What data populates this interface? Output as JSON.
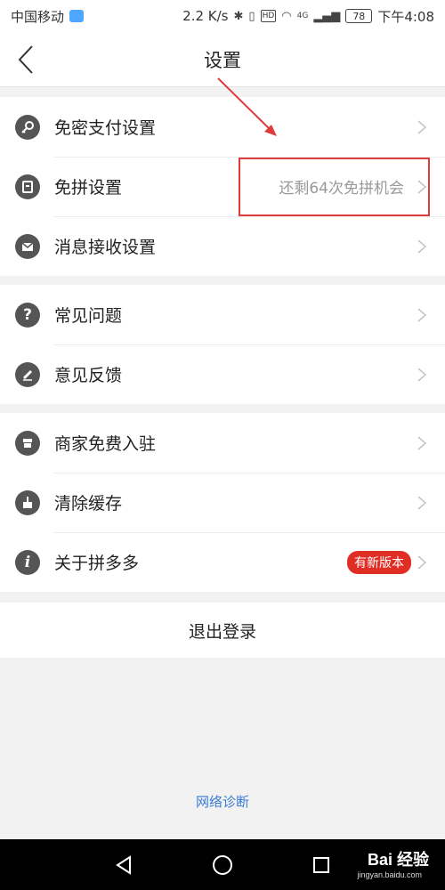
{
  "status_bar": {
    "carrier": "中国移动",
    "speed": "2.2 K/s",
    "battery": "78",
    "network": "4G",
    "hd": "HD",
    "time": "下午4:08"
  },
  "header": {
    "title": "设置"
  },
  "groups": [
    {
      "items": [
        {
          "label": "免密支付设置",
          "icon": "key-icon"
        },
        {
          "label": "免拼设置",
          "value": "还剩64次免拼机会",
          "icon": "coupon-icon"
        },
        {
          "label": "消息接收设置",
          "icon": "envelope-icon"
        }
      ]
    },
    {
      "items": [
        {
          "label": "常见问题",
          "icon": "question-icon"
        },
        {
          "label": "意见反馈",
          "icon": "pencil-icon"
        }
      ]
    },
    {
      "items": [
        {
          "label": "商家免费入驻",
          "icon": "shop-icon"
        },
        {
          "label": "清除缓存",
          "icon": "broom-icon"
        },
        {
          "label": "关于拼多多",
          "badge": "有新版本",
          "icon": "info-icon"
        }
      ]
    }
  ],
  "logout_label": "退出登录",
  "network_diagnosis_label": "网络诊断",
  "watermark": {
    "text": "Bai 经验",
    "sub": "jingyan.baidu.com"
  },
  "colors": {
    "badge": "#e02e24",
    "link": "#3a7bd5",
    "annotation": "#e03b3b"
  }
}
